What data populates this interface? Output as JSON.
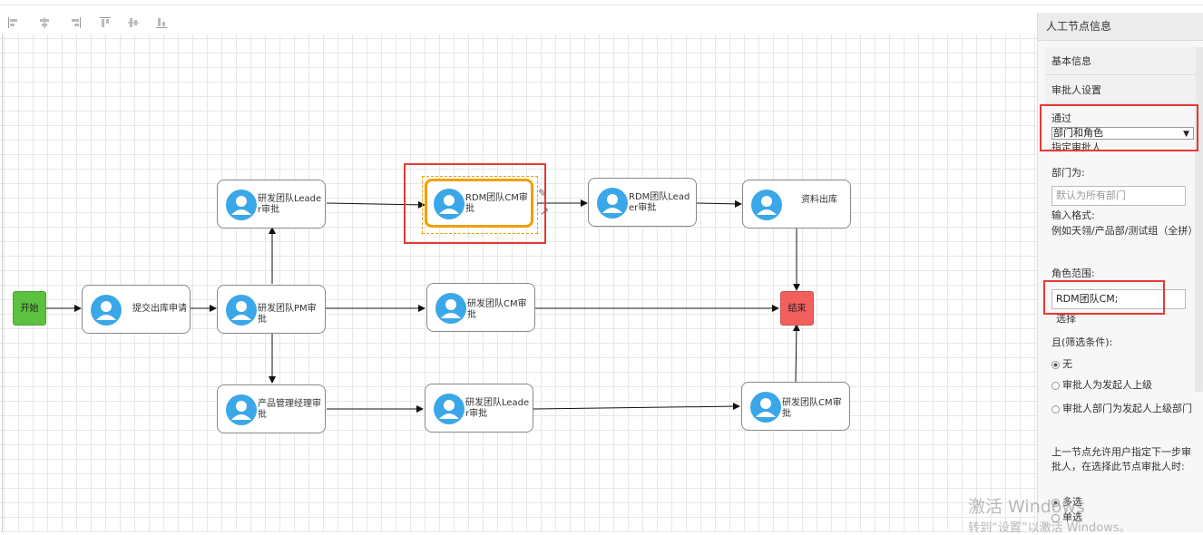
{
  "toolbar": {
    "icons": [
      "align-left-icon",
      "align-center-icon",
      "align-right-icon",
      "align-top-icon",
      "align-middle-icon",
      "align-bottom-icon"
    ]
  },
  "flow": {
    "start": {
      "label": "开始",
      "color": "#5bc13f"
    },
    "end": {
      "label": "结束",
      "color": "#f25f5c"
    },
    "nodes": [
      {
        "id": "submit",
        "label": "提交出库申请"
      },
      {
        "id": "rd-pm",
        "label": "研发团队PM审批"
      },
      {
        "id": "rd-leader-top",
        "label": "研发团队Leader审批"
      },
      {
        "id": "rdm-cm",
        "label": "RDM团队CM审批"
      },
      {
        "id": "rdm-leader",
        "label": "RDM团队Leader审批"
      },
      {
        "id": "release",
        "label": "资料出库"
      },
      {
        "id": "rd-cm-mid",
        "label": "研发团队CM审批"
      },
      {
        "id": "pm-manager",
        "label": "产品管理经理审批"
      },
      {
        "id": "rd-leader-bottom",
        "label": "研发团队Leader审批"
      },
      {
        "id": "rd-cm-bottom",
        "label": "研发团队CM审批"
      }
    ],
    "accent_color": "#f0a000",
    "avatar_color": "#3aa7e8",
    "highlight_color": "#e53935"
  },
  "panel": {
    "title": "人工节点信息",
    "sections": {
      "basic": "基本信息",
      "approver": "审批人设置"
    },
    "via_label": "通过",
    "via_value": "部门和角色",
    "assign_label": "指定审批人",
    "dept_label": "部门为:",
    "dept_placeholder": "默认为所有部门",
    "format_label": "输入格式:",
    "format_example": "例如天翎/产品部/测试组（全拼）",
    "role_label": "角色范围:",
    "role_value": "RDM团队CM;",
    "choose_label": "选择",
    "filter_label": "且(筛选条件):",
    "filter_options": [
      {
        "label": "无",
        "checked": true
      },
      {
        "label": "审批人为发起人上级",
        "checked": false
      },
      {
        "label": "审批人部门为发起人上级部门",
        "checked": false
      }
    ],
    "next_step_note": "上一节点允许用户指定下一步审批人，在选择此节点审批人时:",
    "select_modes": [
      {
        "label": "多选",
        "checked": true
      },
      {
        "label": "单选",
        "checked": false
      }
    ]
  },
  "watermark": {
    "line1": "激活 Windows",
    "line2": "转到“设置”以激活 Windows。"
  }
}
